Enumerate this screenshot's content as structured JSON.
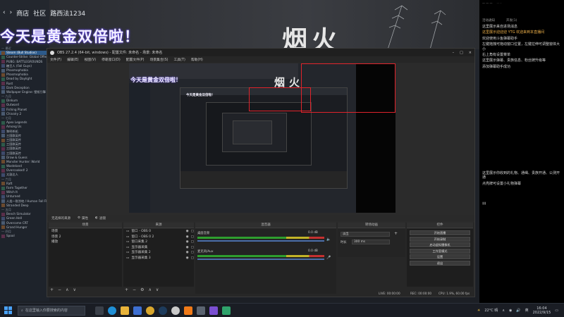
{
  "steam": {
    "nav": [
      "商店",
      "社区",
      "路西法1234"
    ],
    "library": [
      {
        "label": "— 最近",
        "head": true
      },
      {
        "label": "Steam (Bull Studios)",
        "hl": true
      },
      {
        "label": "Counter-Strike: Global Offensive"
      },
      {
        "label": "PUBG: BATTLEGROUNDS"
      },
      {
        "label": "糖豆人 (Fall Guys)"
      },
      {
        "label": "Phasmophobia"
      },
      {
        "label": "Phasmophobia"
      },
      {
        "label": "Dead by Daylight"
      },
      {
        "label": "Rust"
      },
      {
        "label": "Dark Deception"
      },
      {
        "label": "Wallpaper Engine: 壁纸引擎"
      },
      {
        "label": "— 九月",
        "head": true
      },
      {
        "label": "Dinkum"
      },
      {
        "label": "Outward"
      },
      {
        "label": "Fishing Planet"
      },
      {
        "label": "Chivalry 2"
      },
      {
        "label": "— 七月",
        "head": true
      },
      {
        "label": "Apex Legends"
      },
      {
        "label": "Among Us"
      },
      {
        "label": "黎明杀机"
      },
      {
        "label": "三国群英传"
      },
      {
        "label": "三国群英传"
      },
      {
        "label": "三国群英传"
      },
      {
        "label": "三国群英传"
      },
      {
        "label": "三国群英传"
      },
      {
        "label": "Draw & Guess"
      },
      {
        "label": "Monster Hunter: World"
      },
      {
        "label": "Wasteland"
      },
      {
        "label": "Overcooked! 2"
      },
      {
        "label": "太鼓达人"
      },
      {
        "label": "— 六月",
        "head": true
      },
      {
        "label": "Raft"
      },
      {
        "label": "Farm Together"
      },
      {
        "label": "Witch It"
      },
      {
        "label": "Unturned"
      },
      {
        "label": "人类一败涂地 / Human Fall Flat"
      },
      {
        "label": "Stranded Deep"
      },
      {
        "label": "— 五月",
        "head": true
      },
      {
        "label": "Bench Simulator"
      },
      {
        "label": "Green Hell"
      },
      {
        "label": "Overcome CRT"
      },
      {
        "label": "Grand Hunger"
      },
      {
        "label": "— 四月",
        "head": true
      },
      {
        "label": "Spool"
      }
    ]
  },
  "hero": {
    "title": "今天是黄金双倍啦！",
    "calligraphy": "烟火"
  },
  "chat": {
    "header_lines": [
      "— — —",
      "· · ·"
    ],
    "tabs": [
      "活动通知",
      "开发(1)"
    ],
    "messages": [
      "这里展示来自进场消息",
      "这里展示迎迎迎 YTG 欢迎来到本直播间",
      "欢迎使用斗鱼弹幕助手",
      "左键拖拽可拖动窗口位置，左键拉伸可调整窗体大小",
      "右上角有设置菜单",
      "这里展示弹幕、贵族信息、粉丝牌升级等",
      "添加弹幕助手成功"
    ],
    "messages_bottom": [
      "这里展示你收到的礼物、通缉、贵族开通、公测开通",
      "点亮牌可设置小礼物弹幕"
    ],
    "side_icon_label": "▮▮"
  },
  "obs": {
    "title": "OBS 27.2.4 (64-bit, windows) - 配置文件: 未命名 - 场景: 未命名",
    "menu": [
      "文件(F)",
      "编辑(E)",
      "视图(V)",
      "停靠窗口(D)",
      "配置文件(P)",
      "场景集合(S)",
      "工具(T)",
      "帮助(H)"
    ],
    "preview_title": "今天是黄金双倍啦！",
    "preview_calligraphy": "烟火",
    "source_bar": [
      "无选择的来源",
      "属性",
      "滤镜"
    ],
    "docks": {
      "scenes": {
        "title": "场景",
        "items": [
          "场景",
          "场景 2",
          "播放"
        ]
      },
      "sources": {
        "title": "来源",
        "items": [
          "窗口 - OBS 0",
          "窗口 - OBS 0 2",
          "窗口采集 2",
          "显示器采集",
          "显示器采集 2",
          "显示器采集 3"
        ]
      },
      "mixer": {
        "title": "混音器",
        "channels": [
          {
            "name": "桌面音频",
            "db": "0.0 dB"
          },
          {
            "name": "麦克风/Aux",
            "db": "0.0 dB"
          }
        ]
      },
      "transitions": {
        "title": "转场动画",
        "type": "淡出",
        "duration_label": "时长",
        "duration": "300 ms"
      },
      "controls": {
        "title": "控件",
        "buttons": [
          "开始直播",
          "开始录制",
          "启动虚拟摄像机",
          "工作室模式",
          "设置",
          "退出"
        ]
      }
    },
    "status": {
      "live": "LIVE: 00:00:00",
      "rec": "REC: 00:00:00",
      "cpu": "CPU: 1.9%, 60.00 fps"
    }
  },
  "taskbar": {
    "search_placeholder": "在这里输入你要搜索的内容",
    "weather": "22°C 晴",
    "ime": "英",
    "time": "16:04",
    "date": "2022/9/15"
  },
  "colors": {
    "obs_bg": "#2b2b2b",
    "accent_red": "#e0232b",
    "title_glow": "#6a4cff",
    "meter_green": "#2e9e2e",
    "taskbar": "#1a1d24"
  }
}
